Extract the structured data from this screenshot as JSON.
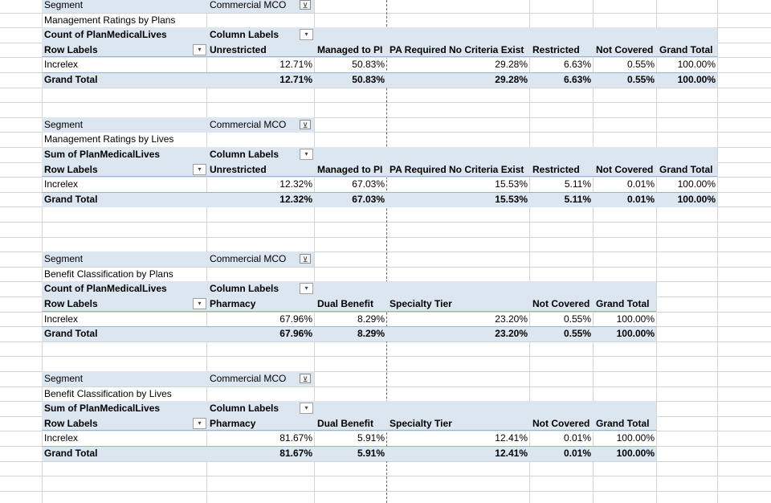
{
  "pivots": [
    {
      "segment_label": "Segment",
      "segment_value": "Commercial MCO",
      "title": "Management Ratings by Plans",
      "measure": "Count of PlanMedicalLives",
      "column_labels": "Column Labels",
      "row_labels": "Row Labels",
      "headers": [
        "Unrestricted",
        "Managed to PI",
        "PA Required No Criteria Exist",
        "Restricted",
        "Not Covered",
        "Grand Total"
      ],
      "row": {
        "label": "Increlex",
        "values": [
          "12.71%",
          "50.83%",
          "29.28%",
          "6.63%",
          "0.55%",
          "100.00%"
        ]
      },
      "total": {
        "label": "Grand Total",
        "values": [
          "12.71%",
          "50.83%",
          "29.28%",
          "6.63%",
          "0.55%",
          "100.00%"
        ]
      }
    },
    {
      "segment_label": "Segment",
      "segment_value": "Commercial MCO",
      "title": "Management Ratings by Lives",
      "measure": "Sum of PlanMedicalLives",
      "column_labels": "Column Labels",
      "row_labels": "Row Labels",
      "headers": [
        "Unrestricted",
        "Managed to PI",
        "PA Required No Criteria Exist",
        "Restricted",
        "Not Covered",
        "Grand Total"
      ],
      "row": {
        "label": "Increlex",
        "values": [
          "12.32%",
          "67.03%",
          "15.53%",
          "5.11%",
          "0.01%",
          "100.00%"
        ]
      },
      "total": {
        "label": "Grand Total",
        "values": [
          "12.32%",
          "67.03%",
          "15.53%",
          "5.11%",
          "0.01%",
          "100.00%"
        ]
      }
    },
    {
      "segment_label": "Segment",
      "segment_value": "Commercial MCO",
      "title": "Benefit Classification by Plans",
      "measure": "Count of PlanMedicalLives",
      "column_labels": "Column Labels",
      "row_labels": "Row Labels",
      "headers": [
        "Pharmacy",
        "Dual Benefit",
        "Specialty Tier",
        "Not Covered",
        "Grand Total"
      ],
      "row": {
        "label": "Increlex",
        "values": [
          "67.96%",
          "8.29%",
          "23.20%",
          "0.55%",
          "100.00%"
        ]
      },
      "total": {
        "label": "Grand Total",
        "values": [
          "67.96%",
          "8.29%",
          "23.20%",
          "0.55%",
          "100.00%"
        ]
      }
    },
    {
      "segment_label": "Segment",
      "segment_value": "Commercial MCO",
      "title": "Benefit Classification by Lives",
      "measure": "Sum of PlanMedicalLives",
      "column_labels": "Column Labels",
      "row_labels": "Row Labels",
      "headers": [
        "Pharmacy",
        "Dual Benefit",
        "Specialty Tier",
        "Not Covered",
        "Grand Total"
      ],
      "row": {
        "label": "Increlex",
        "values": [
          "81.67%",
          "5.91%",
          "12.41%",
          "0.01%",
          "100.00%"
        ]
      },
      "total": {
        "label": "Grand Total",
        "values": [
          "81.67%",
          "5.91%",
          "12.41%",
          "0.01%",
          "100.00%"
        ]
      }
    }
  ],
  "icons": {
    "filter": "filter-applied-icon",
    "dropdown": "dropdown-arrow-icon"
  },
  "colors": {
    "pivot_band": "#dce6f1",
    "gridline": "#d4d4d4",
    "page_break": "#6b6b6b"
  }
}
